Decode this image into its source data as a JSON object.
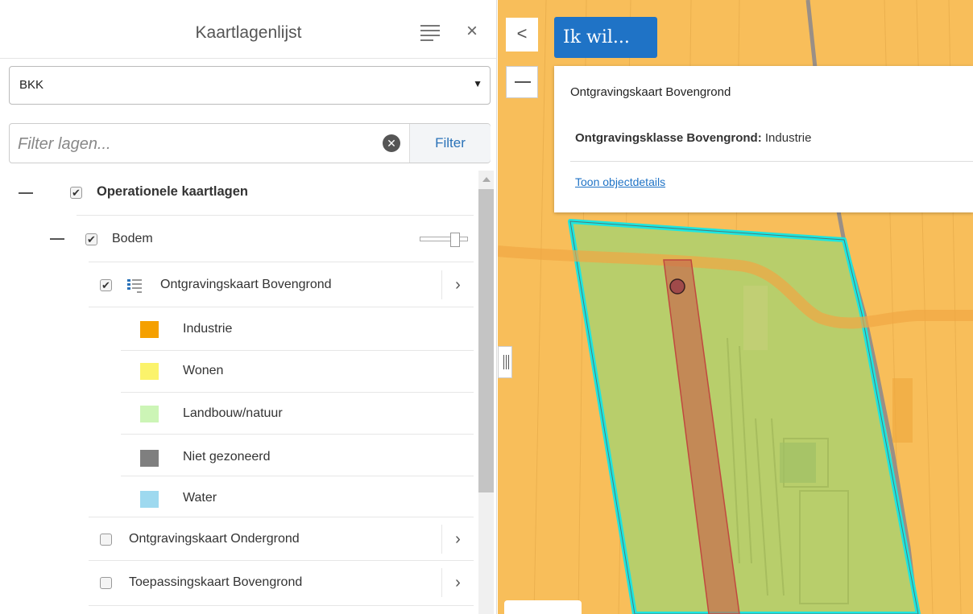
{
  "panel": {
    "title": "Kaartlagenlijst",
    "menu_icon": "hamburger-icon",
    "close_label": "×"
  },
  "basemap": {
    "selected": "BKK",
    "caret": "▼"
  },
  "filter": {
    "placeholder": "Filter lagen...",
    "clear_icon": "clear-circle-icon",
    "clear_glyph": "✕",
    "button_label": "Filter"
  },
  "tree": {
    "operational": {
      "label": "Operationele kaartlagen",
      "checked": true
    },
    "bodem": {
      "label": "Bodem",
      "checked": true,
      "opacity": 0.7
    },
    "layers": [
      {
        "label": "Ontgravingskaart Bovengrond",
        "checked": true,
        "expanded": true
      },
      {
        "label": "Ontgravingskaart Ondergrond",
        "checked": false
      },
      {
        "label": "Toepassingskaart Bovengrond",
        "checked": false
      }
    ],
    "legend": [
      {
        "label": "Industrie",
        "color": "#f5a000"
      },
      {
        "label": "Wonen",
        "color": "#fbf36b"
      },
      {
        "label": "Landbouw/natuur",
        "color": "#ccf5b6"
      },
      {
        "label": "Niet gezoneerd",
        "color": "#7f7f7f"
      },
      {
        "label": "Water",
        "color": "#9ed9ef"
      }
    ],
    "check_glyph": "✔",
    "chevron": "›"
  },
  "map": {
    "collapse_label": "<",
    "ik_wil_label": "Ik wil...",
    "colors": {
      "industrie": "#f8be5a",
      "selection_outline": "#1de5e0",
      "polygon_fill": "#b9cf6f",
      "highlight": "#c86c4d"
    }
  },
  "popup": {
    "title": "Ontgravingskaart Bovengrond",
    "attr_label": "Ontgravingsklasse Bovengrond:",
    "attr_value": "Industrie",
    "link": "Toon objectdetails"
  }
}
